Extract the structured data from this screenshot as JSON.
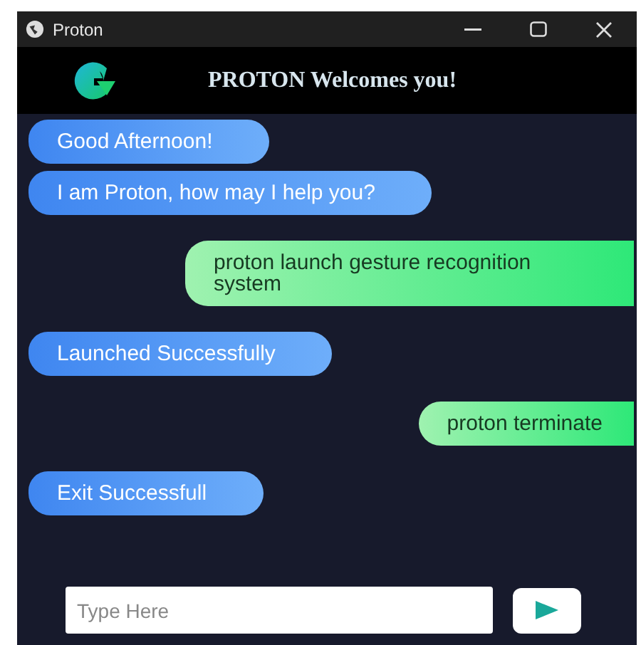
{
  "window": {
    "title": "Proton"
  },
  "header": {
    "title": "PROTON Welcomes you!"
  },
  "messages": [
    {
      "kind": "bot",
      "text": "Good Afternoon!"
    },
    {
      "kind": "bot",
      "text": "I am Proton, how may I help you?"
    },
    {
      "kind": "user",
      "text": "proton launch gesture recognition system"
    },
    {
      "kind": "bot",
      "text": "Launched Successfully"
    },
    {
      "kind": "user",
      "text": "proton terminate"
    },
    {
      "kind": "bot",
      "text": "Exit Successfull"
    }
  ],
  "input": {
    "placeholder": "Type Here"
  }
}
